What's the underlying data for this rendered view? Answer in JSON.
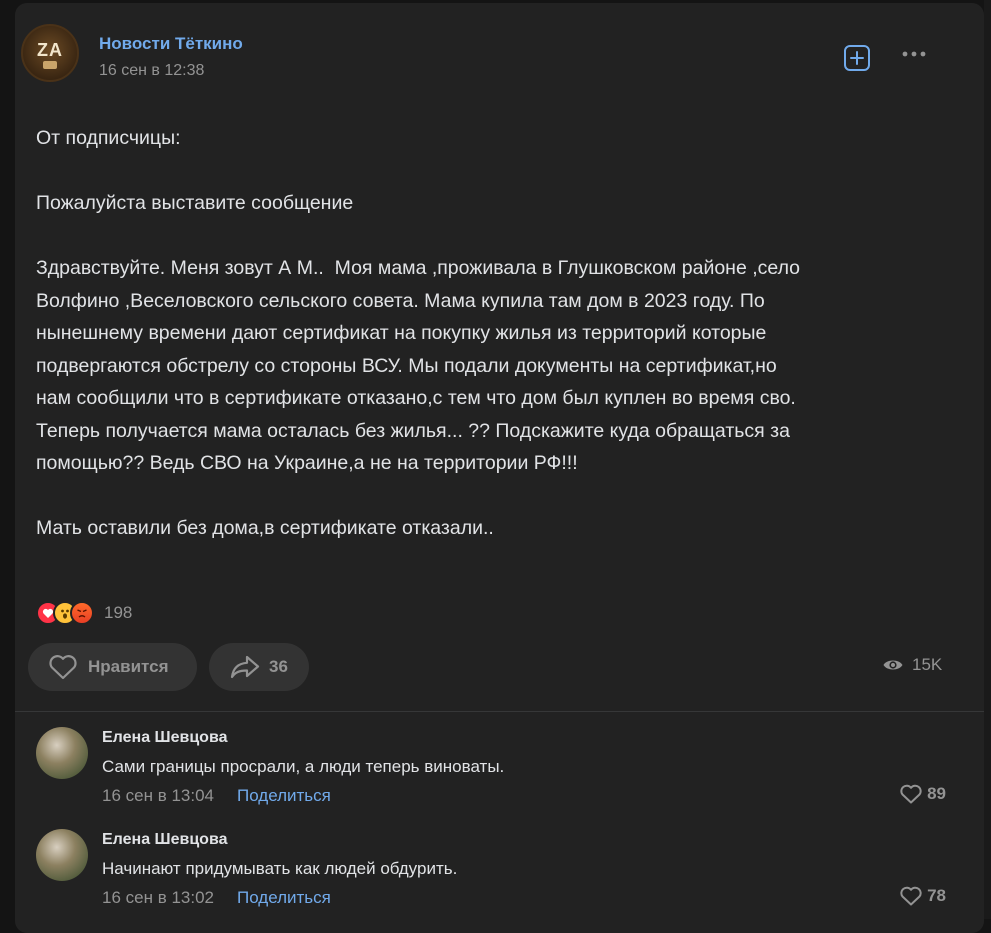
{
  "post": {
    "group_name": "Новости Тёткино",
    "time": "16 сен в 12:38",
    "avatar_text": "ZA",
    "text": "От подписчицы:\n\nПожалуйста выставите сообщение\n\nЗдравствуйте. Меня зовут А М..  Моя мама ,проживала в Глушковском районе ,село\nВолфино ,Веселовского сельского совета. Мама купила там дом в 2023 году. По\nнынешнему времени дают сертификат на покупку жилья из территорий которые\nподвергаются обстрелу со стороны ВСУ. Мы подали документы на сертификат,но\nнам сообщили что в сертификате отказано,с тем что дом был куплен во время сво.\nТеперь получается мама осталась без жилья... ?? Подскажите куда обращаться за\nпомощью?? Ведь СВО на Украине,а не на территории РФ!!!\n\nМать оставили без дома,в сертификате отказали..",
    "reactions_count": "198",
    "like_label": "Нравится",
    "share_count": "36",
    "views": "15K"
  },
  "comments": [
    {
      "author": "Елена Шевцова",
      "text": "Сами границы просрали, а люди теперь виноваты.",
      "time": "16 сен в 13:04",
      "share_label": "Поделиться",
      "likes": "89"
    },
    {
      "author": "Елена Шевцова",
      "text": "Начинают придумывать как людей обдурить.",
      "time": "16 сен в 13:02",
      "share_label": "Поделиться",
      "likes": "78"
    }
  ],
  "icons": {
    "heart_reaction": "heart-icon",
    "wow_reaction": "wow-face-icon",
    "angry_reaction": "angry-face-icon",
    "like": "heart-outline-icon",
    "share": "share-arrow-icon",
    "views": "eye-icon",
    "subscribe": "plus-square-icon",
    "more": "more-dots-icon"
  },
  "colors": {
    "accent": "#71aaeb",
    "card_bg": "#222222",
    "page_bg": "#141414",
    "muted_text": "#939393"
  }
}
